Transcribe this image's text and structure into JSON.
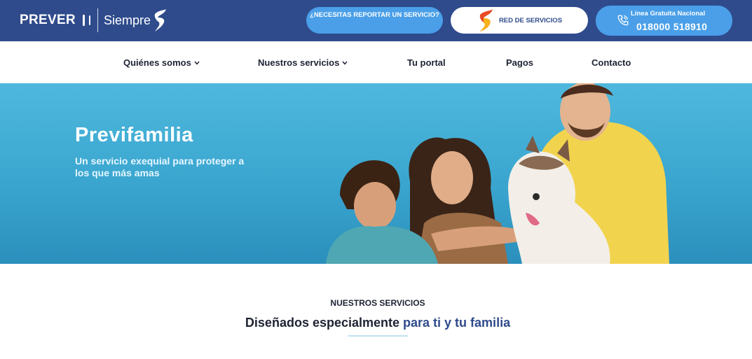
{
  "brand": {
    "logo_primary": "PREVER",
    "logo_secondary": "Siempre",
    "accent_color": "#2f4b8c",
    "button_blue": "#4a9fe8"
  },
  "header_actions": {
    "report_label": "¿NECESITAS REPORTAR UN SERVICIO?",
    "network_label": "RED DE SERVICIOS",
    "hotline_label": "Línea Gratuita Nacional",
    "hotline_number": "018000 518910",
    "hotline_icon": "phone-icon"
  },
  "nav": {
    "items": [
      {
        "label": "Quiénes somos",
        "has_dropdown": true
      },
      {
        "label": "Nuestros servicios",
        "has_dropdown": true
      },
      {
        "label": "Tu portal",
        "has_dropdown": false
      },
      {
        "label": "Pagos",
        "has_dropdown": false
      },
      {
        "label": "Contacto",
        "has_dropdown": false
      }
    ]
  },
  "hero": {
    "title": "Previfamilia",
    "subtitle": "Un servicio exequial para proteger a los que más amas"
  },
  "services": {
    "kicker": "NUESTROS SERVICIOS",
    "title_main": "Diseñados especialmente ",
    "title_accent": "para ti y tu familia"
  }
}
